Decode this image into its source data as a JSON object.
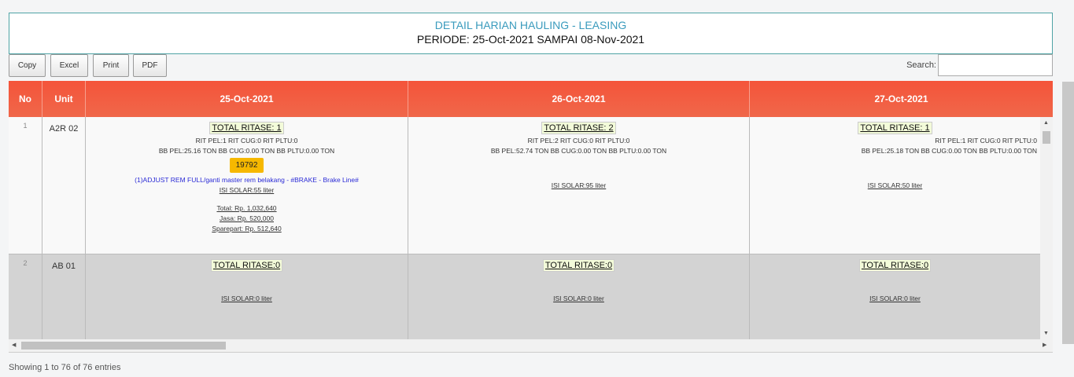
{
  "header": {
    "title": "DETAIL HARIAN HAULING - LEASING",
    "subtitle": "PERIODE: 25-Oct-2021 SAMPAI 08-Nov-2021"
  },
  "toolbar": {
    "buttons": [
      "Copy",
      "Excel",
      "Print",
      "PDF"
    ],
    "search_label": "Search:",
    "search_value": ""
  },
  "table": {
    "columns": [
      "No",
      "Unit",
      "25-Oct-2021",
      "26-Oct-2021",
      "27-Oct-2021"
    ],
    "rows": [
      {
        "no": "1",
        "unit": "A2R 02",
        "days": [
          {
            "ritase": "TOTAL RITASE: 1",
            "rit": "RIT PEL:1 RIT CUG:0 RIT PLTU:0",
            "bb": "BB PEL:25.16 TON  BB CUG:0.00 TON  BB PLTU:0.00 TON",
            "badge": "19792",
            "work": "(1)ADJUST REM FULL/ganti master rem belakang - #BRAKE - Brake Line#",
            "solar": "ISI SOLAR:55 liter",
            "total": "Total: Rp. 1,032,640",
            "jasa": "Jasa: Rp. 520,000",
            "sparepart": "Sparepart: Rp. 512,640"
          },
          {
            "ritase": "TOTAL RITASE: 2",
            "rit": "RIT PEL:2 RIT CUG:0 RIT PLTU:0",
            "bb": "BB PEL:52.74 TON  BB CUG:0.00 TON  BB PLTU:0.00 TON",
            "solar": "ISI SOLAR:95 liter"
          },
          {
            "ritase": "TOTAL RITASE: 1",
            "rit": "RIT PEL:1 RIT CUG:0 RIT PLTU:0",
            "bb": "BB PEL:25.18 TON  BB CUG:0.00 TON  BB PLTU:0.00 TON",
            "solar": "ISI SOLAR:50 liter"
          }
        ]
      },
      {
        "no": "2",
        "unit": "AB 01",
        "days": [
          {
            "ritase": "TOTAL RITASE:0",
            "solar": "ISI SOLAR:0 liter"
          },
          {
            "ritase": "TOTAL RITASE:0",
            "solar": "ISI SOLAR:0 liter"
          },
          {
            "ritase": "TOTAL RITASE:0",
            "solar": "ISI SOLAR:0 liter"
          }
        ]
      }
    ]
  },
  "footer": {
    "info": "Showing 1 to 76 of 76 entries"
  },
  "colors": {
    "header_bg": "#f4543a",
    "title_color": "#3a9bbd",
    "badge_bg": "#f6b800",
    "work_text": "#2a2ad6"
  },
  "icons": [
    "arrow-up-icon",
    "arrow-down-icon",
    "arrow-left-icon",
    "arrow-right-icon"
  ]
}
